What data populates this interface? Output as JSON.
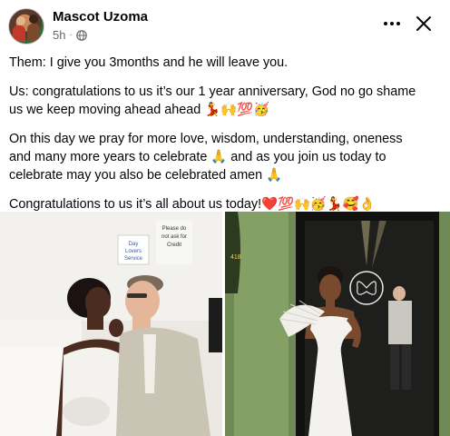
{
  "post": {
    "author": "Mascot Uzoma",
    "time": "5h",
    "paragraphs": [
      {
        "lines": [
          "Them: I give you 3months and he will leave you."
        ]
      },
      {
        "lines": [
          "Us: congratulations to us it’s our 1 year anniversary, God no go shame",
          "us we keep moving ahead ahead"
        ],
        "emoji_tail": "💃🙌💯🥳"
      },
      {
        "lines": [
          "On this day we pray for more love, wisdom, understanding, oneness",
          "and many more years to celebrate 🙏 and as you join us today to",
          "celebrate may you also be celebrated amen 🙏"
        ]
      },
      {
        "lines": [
          "Congratulations to us it’s all about us today!"
        ],
        "emoji_tail": "❤️💯🙌🥳💃🥰👌"
      }
    ],
    "photo_left_sign": [
      "Please do",
      "not ask for",
      "Credit"
    ],
    "photo_left_note": [
      "Day",
      "Lovers",
      "Service"
    ],
    "photo_right_number": "418",
    "icons": [
      "globe-icon",
      "more-icon",
      "close-icon"
    ],
    "colors": {
      "text": "#050505",
      "meta": "#65676b",
      "background": "#ffffff"
    }
  }
}
